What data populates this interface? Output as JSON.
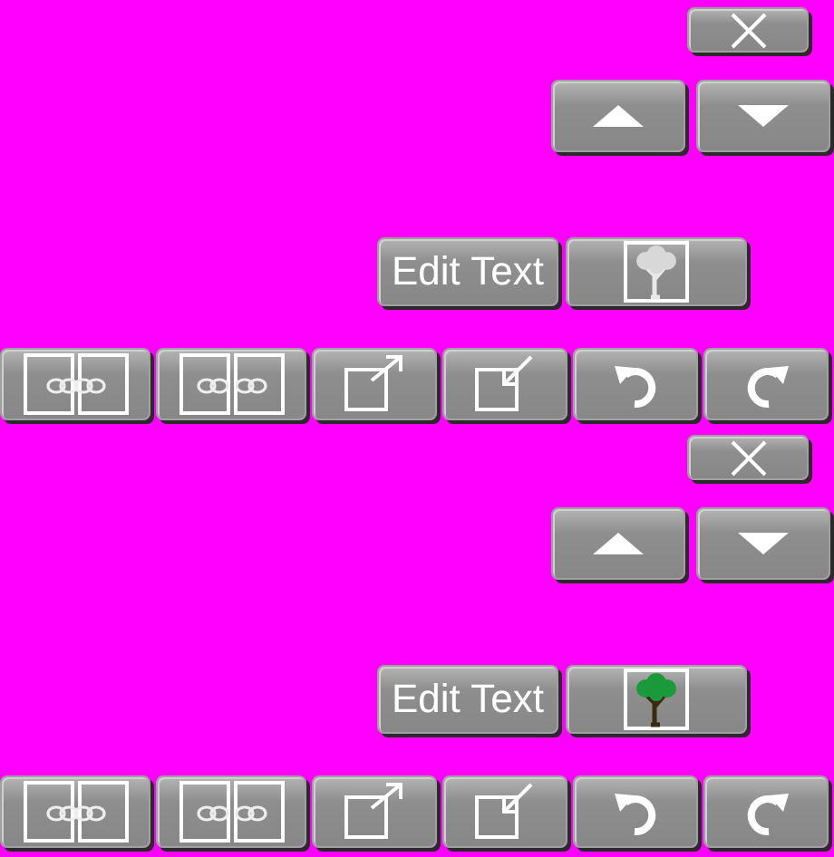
{
  "panels": [
    {
      "edit_button": "Edit Text",
      "tree_in_color": false,
      "tools": [
        {
          "kind": "link"
        },
        {
          "kind": "unlink"
        },
        {
          "kind": "pop-out"
        },
        {
          "kind": "pop-in"
        },
        {
          "kind": "undo"
        },
        {
          "kind": "redo"
        }
      ]
    },
    {
      "edit_button": "Edit Text",
      "tree_in_color": true,
      "tools": [
        {
          "kind": "link"
        },
        {
          "kind": "unlink"
        },
        {
          "kind": "pop-out"
        },
        {
          "kind": "pop-in"
        },
        {
          "kind": "undo"
        },
        {
          "kind": "redo"
        }
      ]
    }
  ]
}
